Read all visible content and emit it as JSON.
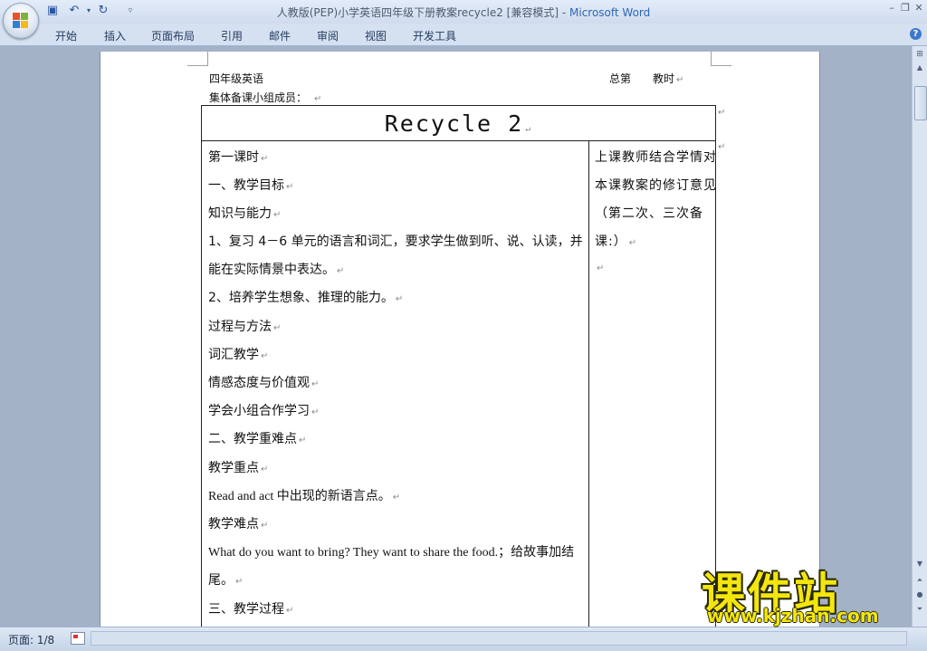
{
  "window": {
    "doc_title": "人教版(PEP)小学英语四年级下册教案recycle2 [兼容模式]",
    "separator": " - ",
    "app_name": "Microsoft Word"
  },
  "ribbon": {
    "tabs": [
      "开始",
      "插入",
      "页面布局",
      "引用",
      "邮件",
      "审阅",
      "视图",
      "开发工具"
    ],
    "help": "?"
  },
  "document": {
    "header_left": "四年级英语",
    "header_right": "总第　　教时",
    "header_members": "集体备课小组成员：",
    "table_title": "Recycle 2",
    "left_lines": [
      "第一课时",
      "一、教学目标",
      "知识与能力",
      "1、复习 4－6 单元的语言和词汇，要求学生做到听、说、认读，并",
      "能在实际情景中表达。",
      "2、培养学生想象、推理的能力。",
      "过程与方法",
      "词汇教学",
      "情感态度与价值观",
      "学会小组合作学习",
      "二、教学重难点",
      "教学重点",
      "Read and act 中出现的新语言点。",
      "教学难点",
      "What do you want to bring? They want to share the food.；给故事加结",
      "尾。",
      "三、教学过程"
    ],
    "right_lines": [
      "上课教师结合学情对",
      "本课教案的修订意见",
      "（第二次、三次备",
      "课:）",
      ""
    ],
    "paragraph_mark": "↵"
  },
  "status": {
    "page": "页面: 1/8"
  },
  "watermark": {
    "cn": "课件站",
    "url": "www.kjzhan.com"
  }
}
